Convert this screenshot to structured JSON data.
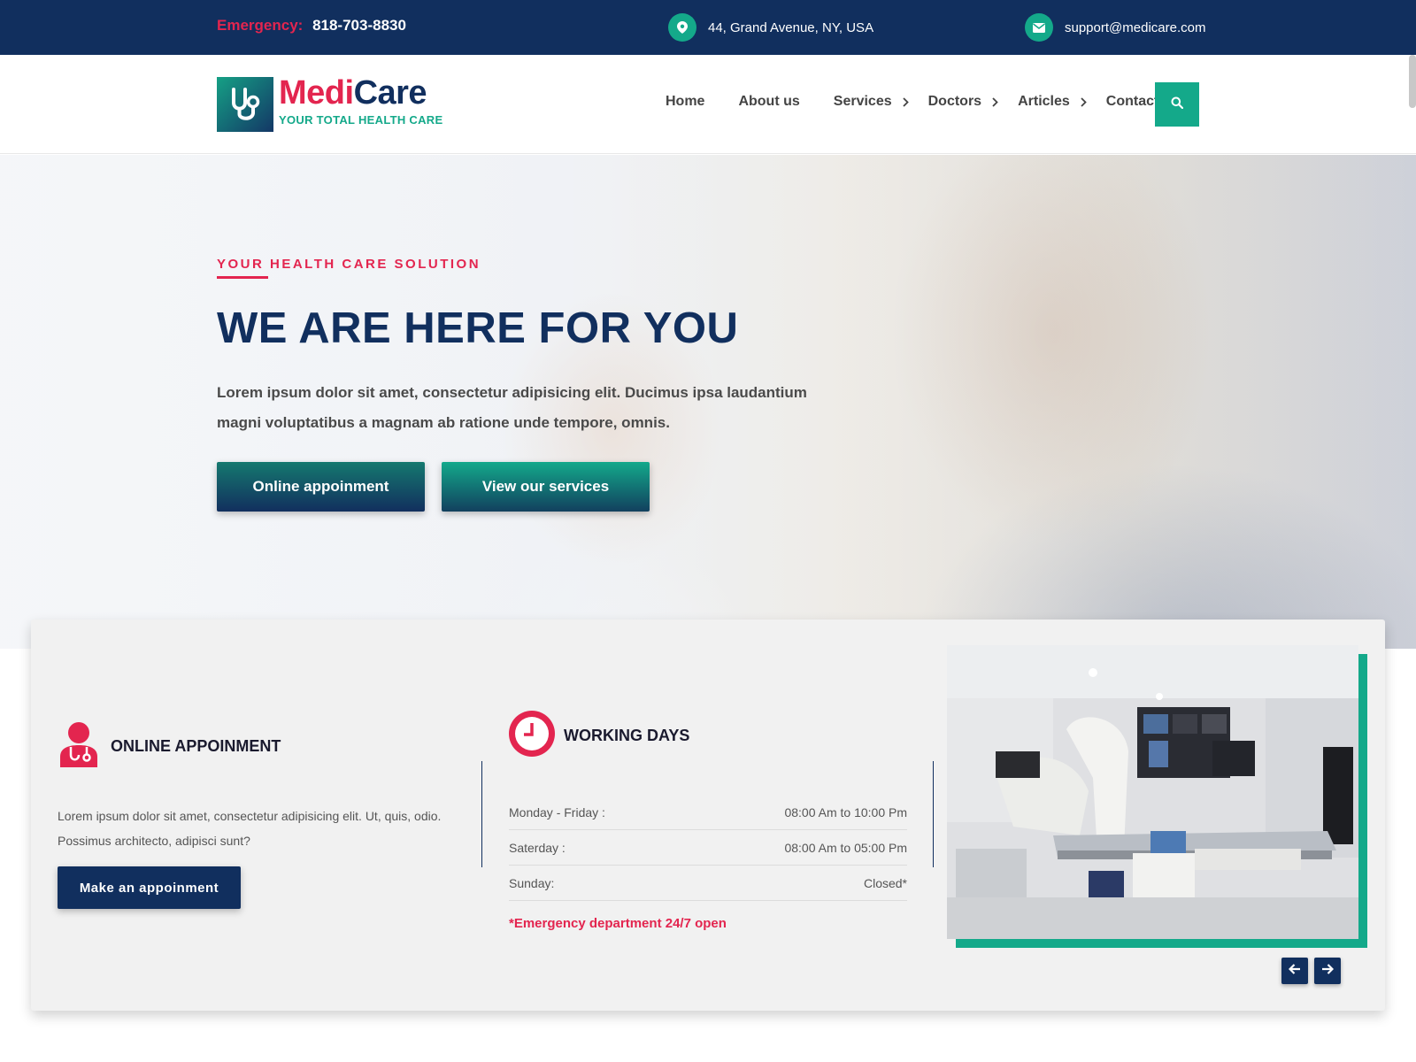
{
  "topbar": {
    "emergency_label": "Emergency:",
    "emergency_phone": "818-703-8830",
    "address": "44, Grand Avenue, NY, USA",
    "email": "support@medicare.com",
    "icons": [
      "map-pin-icon",
      "envelope-icon"
    ]
  },
  "header": {
    "logo": {
      "medi": "Medi",
      "care": "Care",
      "tagline": "YOUR TOTAL HEALTH CARE",
      "icon": "stethoscope-icon"
    },
    "nav": [
      {
        "label": "Home",
        "has_submenu": false
      },
      {
        "label": "About us",
        "has_submenu": false
      },
      {
        "label": "Services",
        "has_submenu": true
      },
      {
        "label": "Doctors",
        "has_submenu": true
      },
      {
        "label": "Articles",
        "has_submenu": true
      },
      {
        "label": "Contact",
        "has_submenu": false
      }
    ],
    "search_icon": "search-icon"
  },
  "hero": {
    "kicker": "YOUR HEALTH CARE SOLUTION",
    "title": "WE ARE HERE FOR YOU",
    "text": "Lorem ipsum dolor sit amet, consectetur adipisicing elit. Ducimus ipsa laudantium magni voluptatibus a magnam ab ratione unde tempore, omnis.",
    "btn_appointment": "Online appoinment",
    "btn_services": "View our services"
  },
  "info": {
    "appointment": {
      "title": "ONLINE APPOINMENT",
      "text": "Lorem ipsum dolor sit amet, consectetur adipisicing elit. Ut, quis, odio. Possimus architecto, adipisci sunt?",
      "button": "Make an appoinment",
      "icon": "doctor-icon"
    },
    "working_days": {
      "title": "WORKING DAYS",
      "icon": "clock-icon",
      "rows": [
        {
          "day": "Monday - Friday :",
          "hours": "08:00 Am to 10:00 Pm"
        },
        {
          "day": "Saterday :",
          "hours": "08:00 Am to 05:00 Pm"
        },
        {
          "day": "Sunday:",
          "hours": "Closed*"
        }
      ],
      "note": "*Emergency department 24/7 open"
    },
    "slider": {
      "prev_icon": "arrow-left-icon",
      "next_icon": "arrow-right-icon"
    }
  },
  "colors": {
    "navy": "#112f5e",
    "accent_red": "#e3254f",
    "accent_green": "#14a98a"
  }
}
